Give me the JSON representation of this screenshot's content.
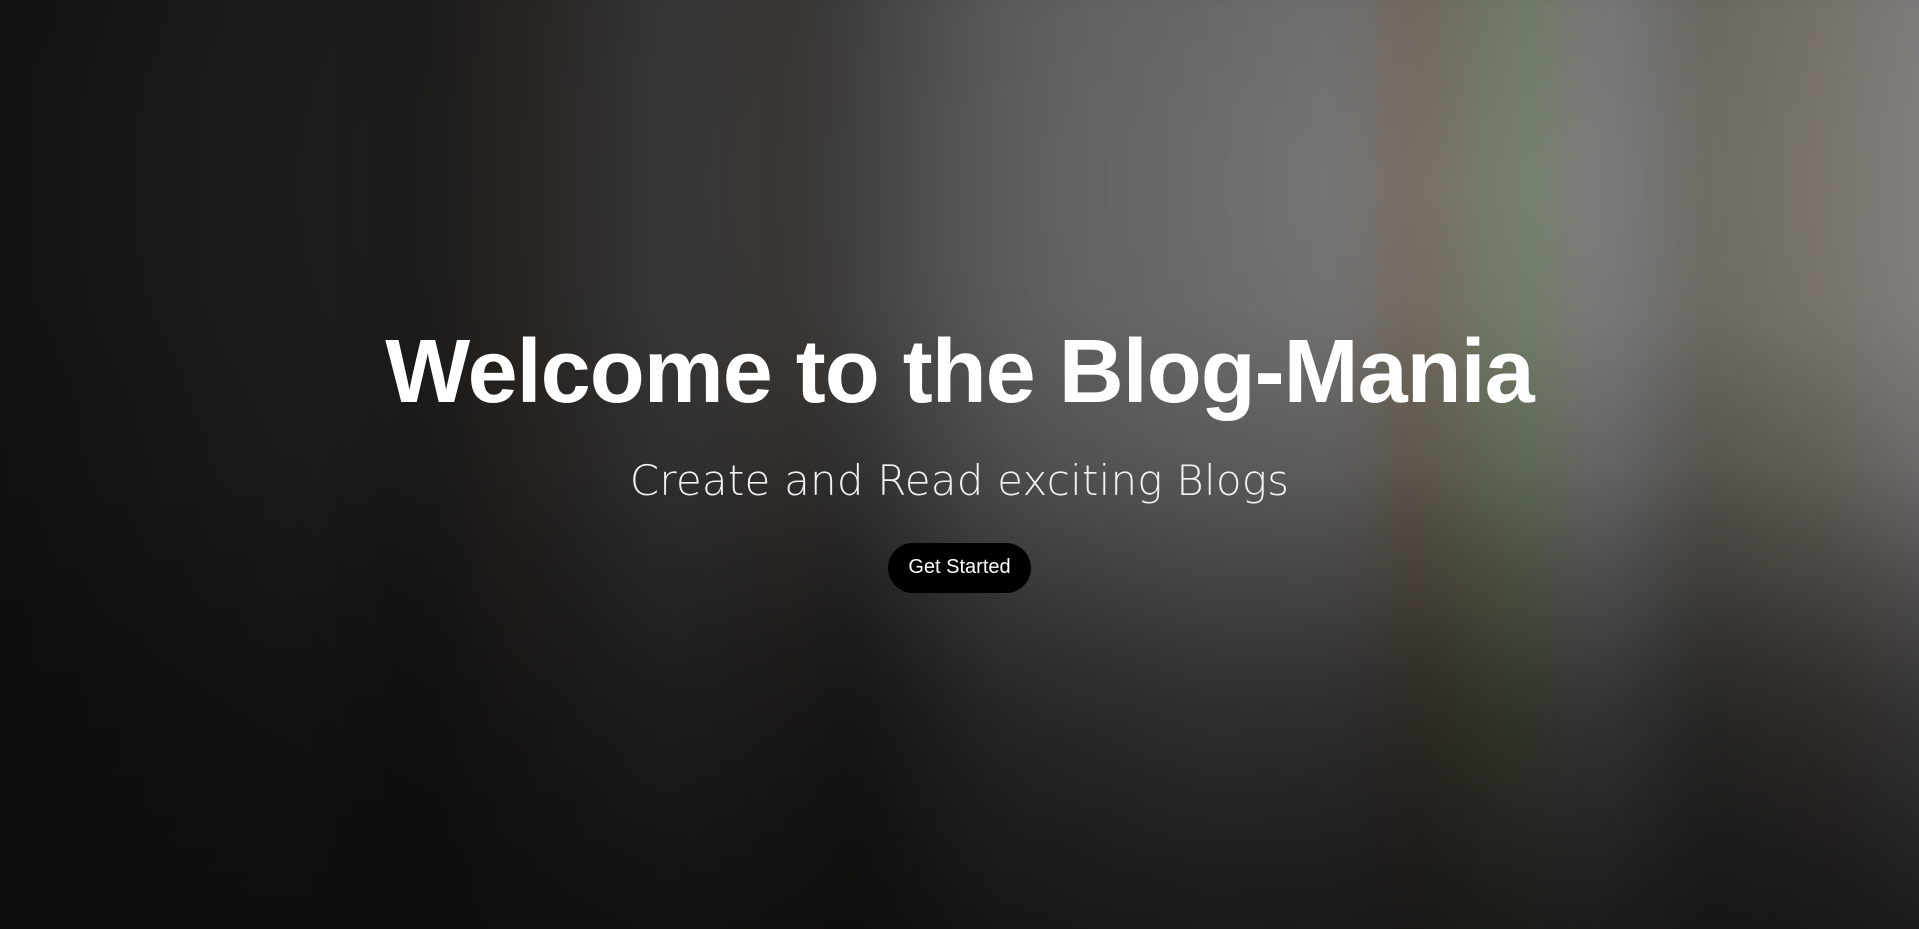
{
  "hero": {
    "title": "Welcome to the Blog-Mania",
    "subtitle": "Create and Read exciting Blogs",
    "cta_label": "Get Started"
  },
  "colors": {
    "text": "#ffffff",
    "button_bg": "#000000",
    "background_base": "#1f1f1f"
  }
}
